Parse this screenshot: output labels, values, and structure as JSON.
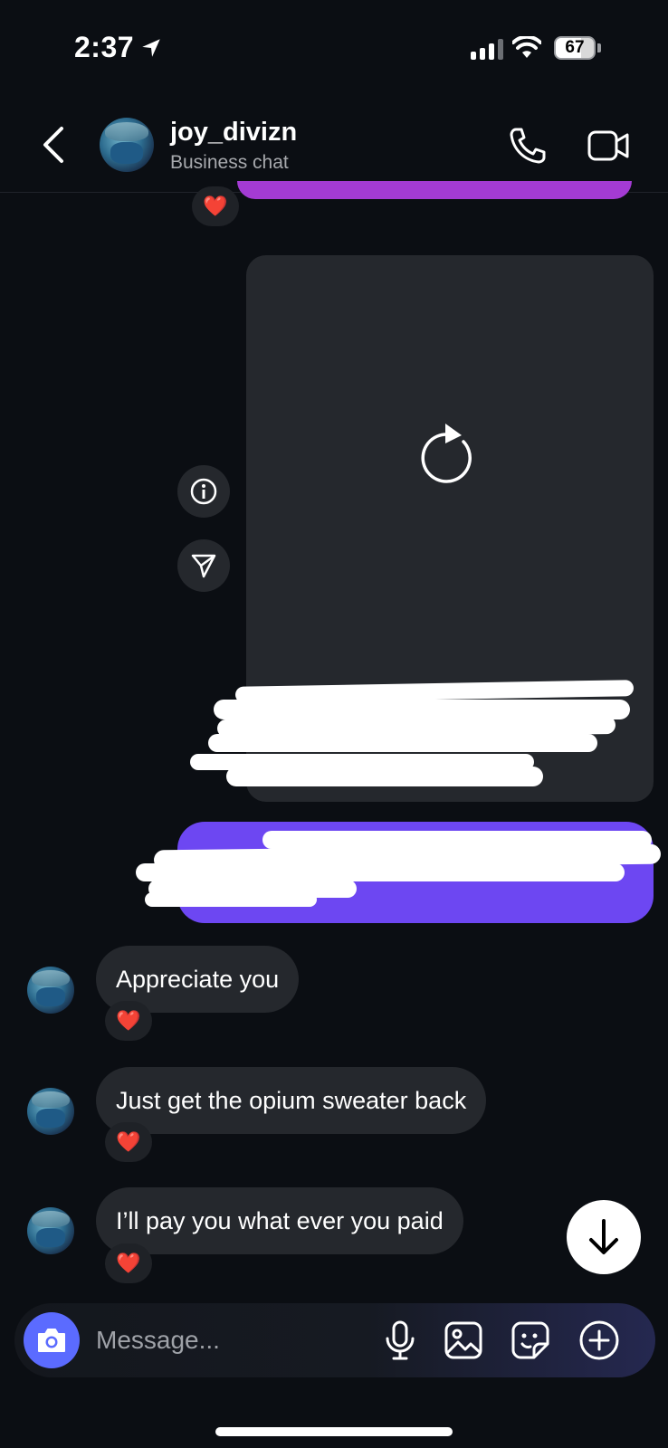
{
  "status_bar": {
    "time": "2:37",
    "battery": "67",
    "battery_level": 0.67,
    "signal_bars_active": 3,
    "signal_bars_total": 4
  },
  "header": {
    "username": "joy_divizn",
    "subtitle": "Business chat"
  },
  "messages": [
    {
      "text": "Appreciate you",
      "reaction": "❤️"
    },
    {
      "text": "Just get the opium sweater back",
      "reaction": "❤️"
    },
    {
      "text": "I’ll pay you what ever you paid",
      "reaction": "❤️"
    }
  ],
  "top_reaction": "❤️",
  "composer": {
    "placeholder": "Message..."
  },
  "colors": {
    "background": "#0b0e13",
    "outgoing_bubble": "#6d47f2",
    "previous_bubble": "#a43bd4",
    "incoming_bubble": "#25282d",
    "camera_button": "#5b6bff"
  },
  "icons": {
    "location": "location-arrow-icon",
    "back": "chevron-left-icon",
    "call": "phone-icon",
    "video": "video-camera-icon",
    "reload": "reload-icon",
    "info": "info-icon",
    "share": "send-icon",
    "scroll_down": "arrow-down-icon",
    "camera": "camera-icon",
    "mic": "microphone-icon",
    "gallery": "image-icon",
    "sticker": "sticker-icon",
    "add": "plus-circle-icon"
  }
}
